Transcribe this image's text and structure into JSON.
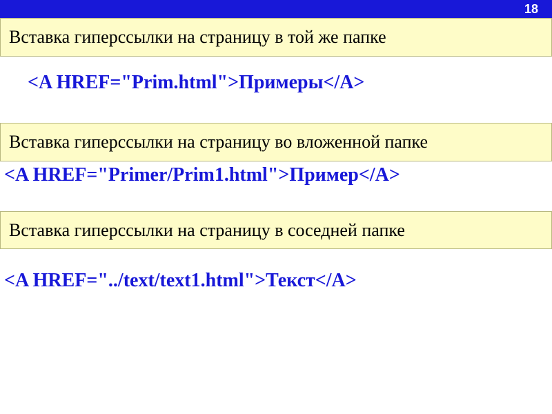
{
  "page_number": "18",
  "section1": {
    "heading": "Вставка гиперссылки на страницу в той же папке",
    "code": "<A HREF=\"Prim.html\">Примеры</A>"
  },
  "section2": {
    "heading": "Вставка гиперссылки на страницу во вложенной папке",
    "code": "<A HREF=\"Primer/Prim1.html\">Пример</A>"
  },
  "section3": {
    "heading": "Вставка гиперссылки на страницу в соседней папке",
    "code": "<A HREF=\"../text/text1.html\">Текст</A>"
  }
}
